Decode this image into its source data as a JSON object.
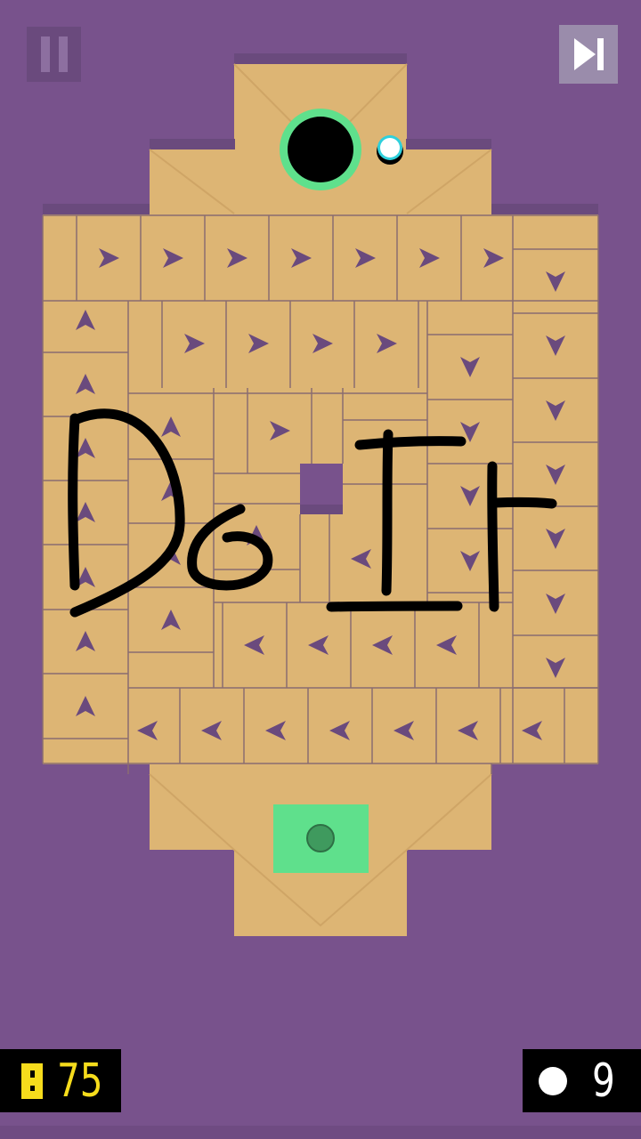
{
  "hud": {
    "pause_icon": "pause-icon",
    "skip_icon": "skip-level-icon",
    "coin_icon": "coin-icon",
    "coins": "75",
    "ball_icon": "ball-icon",
    "balls": "9"
  },
  "board": {
    "hole_icon": "hole-icon",
    "target_icon": "target-pad-icon",
    "colors": {
      "background": "#78528c",
      "floor": "#ddb574",
      "arrow": "#6a4a7d",
      "hole_ring": "#5fe08c",
      "target": "#5fe08c",
      "coin": "#f6dc1c"
    }
  },
  "tiles": [
    [
      "r",
      1,
      "right"
    ],
    [
      "r",
      2,
      "right"
    ],
    [
      "r",
      3,
      "right"
    ],
    [
      "r",
      4,
      "right"
    ],
    [
      "r",
      5,
      "right"
    ],
    [
      "r",
      6,
      "right"
    ],
    [
      "r",
      7,
      "right"
    ],
    [
      "r",
      8,
      "down"
    ],
    [
      "r",
      9,
      "down"
    ],
    [
      "r",
      10,
      "down"
    ],
    [
      "r",
      11,
      "down"
    ],
    [
      "r",
      12,
      "down"
    ],
    [
      "r",
      13,
      "down"
    ],
    [
      "r",
      14,
      "down"
    ],
    [
      "r",
      15,
      "up"
    ],
    [
      "r",
      16,
      "up"
    ],
    [
      "r",
      17,
      "up"
    ],
    [
      "r",
      18,
      "up"
    ],
    [
      "r",
      19,
      "up"
    ],
    [
      "r",
      20,
      "up"
    ],
    [
      "r",
      21,
      "up"
    ],
    [
      "r",
      22,
      "right"
    ],
    [
      "r",
      23,
      "right"
    ],
    [
      "r",
      24,
      "right"
    ],
    [
      "r",
      25,
      "right"
    ],
    [
      "r",
      26,
      "down"
    ],
    [
      "r",
      27,
      "down"
    ],
    [
      "r",
      28,
      "down"
    ],
    [
      "r",
      29,
      "down"
    ],
    [
      "r",
      30,
      "up"
    ],
    [
      "r",
      31,
      "up"
    ],
    [
      "r",
      32,
      "up"
    ],
    [
      "r",
      33,
      "up"
    ],
    [
      "r",
      34,
      "right"
    ],
    [
      "r",
      35,
      "up"
    ],
    [
      "r",
      36,
      "left"
    ],
    [
      "r",
      37,
      "left"
    ],
    [
      "r",
      38,
      "left"
    ],
    [
      "r",
      39,
      "left"
    ],
    [
      "r",
      40,
      "left"
    ],
    [
      "r",
      41,
      "left"
    ],
    [
      "r",
      42,
      "left"
    ],
    [
      "r",
      43,
      "left"
    ],
    [
      "r",
      44,
      "left"
    ],
    [
      "r",
      45,
      "left"
    ],
    [
      "r",
      46,
      "left"
    ],
    [
      "r",
      47,
      "left"
    ]
  ],
  "drawing": {
    "icon": "handwritten-doodle",
    "text": "Do It"
  }
}
